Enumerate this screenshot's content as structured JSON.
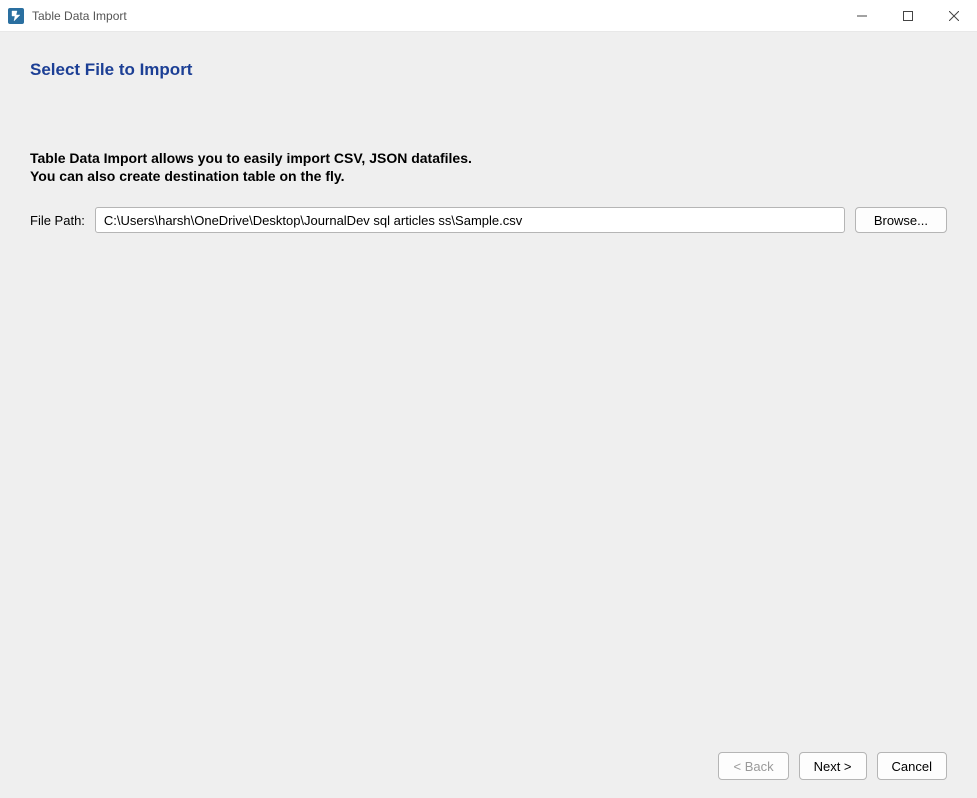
{
  "window": {
    "title": "Table Data Import"
  },
  "page": {
    "heading": "Select File to Import",
    "description_line1": "Table Data Import allows you to easily import CSV, JSON datafiles.",
    "description_line2": "You can also create destination table on the fly."
  },
  "file": {
    "label": "File Path:",
    "value": "C:\\Users\\harsh\\OneDrive\\Desktop\\JournalDev sql articles ss\\Sample.csv",
    "browse_label": "Browse..."
  },
  "footer": {
    "back_label": "< Back",
    "next_label": "Next >",
    "cancel_label": "Cancel"
  }
}
